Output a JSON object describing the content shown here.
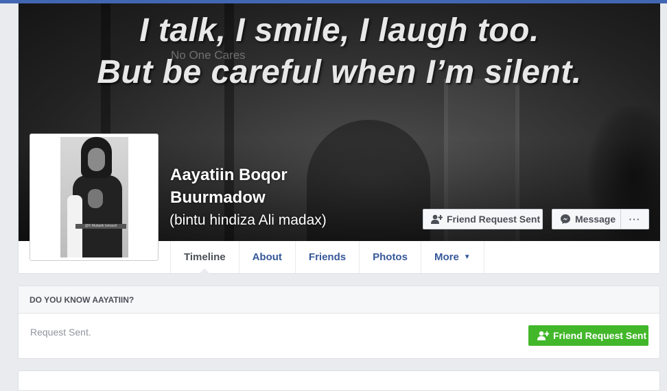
{
  "cover": {
    "quote_line_1": "I talk, I smile, I laugh too.",
    "quote_line_2": "But be careful when I’m silent.",
    "watermark": "No One Cares"
  },
  "avatar": {
    "caption": "@© Mubarik Ismacel"
  },
  "profile": {
    "name": "Aayatiin Boqor Buurmadow",
    "alternate_name": "(bintu hindiza Ali madax)"
  },
  "actions": {
    "friend_request_label": "Friend Request Sent",
    "message_label": "Message",
    "more_actions_label": "···"
  },
  "tabs": [
    {
      "label": "Timeline"
    },
    {
      "label": "About"
    },
    {
      "label": "Friends"
    },
    {
      "label": "Photos"
    },
    {
      "label": "More"
    }
  ],
  "know_card": {
    "title": "DO YOU KNOW AAYATIIN?",
    "status": "Request Sent.",
    "button_label": "Friend Request Sent"
  },
  "colors": {
    "facebook_blue": "#4267b2",
    "link_blue": "#365899",
    "green": "#42b72a"
  }
}
